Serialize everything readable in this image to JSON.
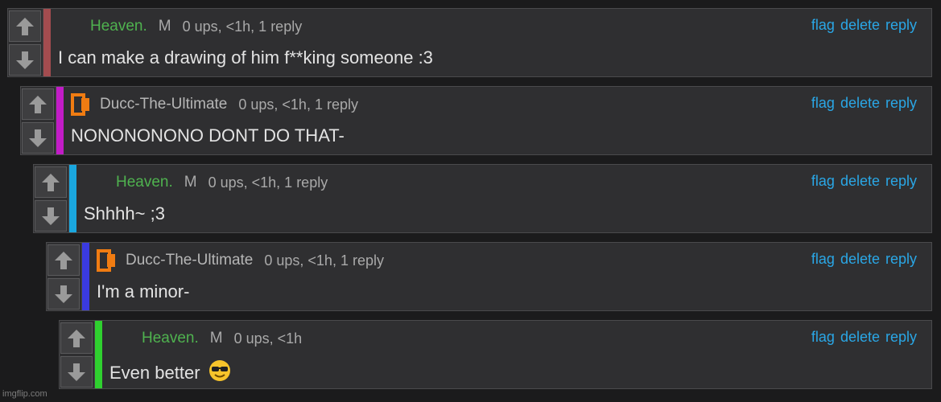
{
  "colors": {
    "comment_bg": "#2f2f31",
    "link": "#2aa7e6",
    "username_green": "#4fb24f",
    "accent_1": "#a34c4f",
    "accent_2": "#c21cc7",
    "accent_3": "#1aa7df",
    "accent_4": "#3a3ae0",
    "accent_5": "#2fd02f"
  },
  "icons": {
    "upvote": "arrow-up-icon",
    "downvote": "arrow-down-icon",
    "avatar": "orange-bracket-avatar-icon",
    "emoji": "sunglasses-emoji-icon"
  },
  "actions": {
    "flag": "flag",
    "delete": "delete",
    "reply": "reply"
  },
  "comments": [
    {
      "username": "Heaven.",
      "marker": "M",
      "stats": "0 ups, <1h, 1 reply",
      "text": "I can make a drawing of him f**king someone :3"
    },
    {
      "username": "Ducc-The-Ultimate",
      "stats": "0 ups, <1h, 1 reply",
      "text": "NONONONONO DONT DO THAT-"
    },
    {
      "username": "Heaven.",
      "marker": "M",
      "stats": "0 ups, <1h, 1 reply",
      "text": "Shhhh~ ;3"
    },
    {
      "username": "Ducc-The-Ultimate",
      "stats": "0 ups, <1h, 1 reply",
      "text": "I'm a minor-"
    },
    {
      "username": "Heaven.",
      "marker": "M",
      "stats": "0 ups, <1h",
      "text": "Even better"
    }
  ],
  "watermark": "imgflip.com"
}
